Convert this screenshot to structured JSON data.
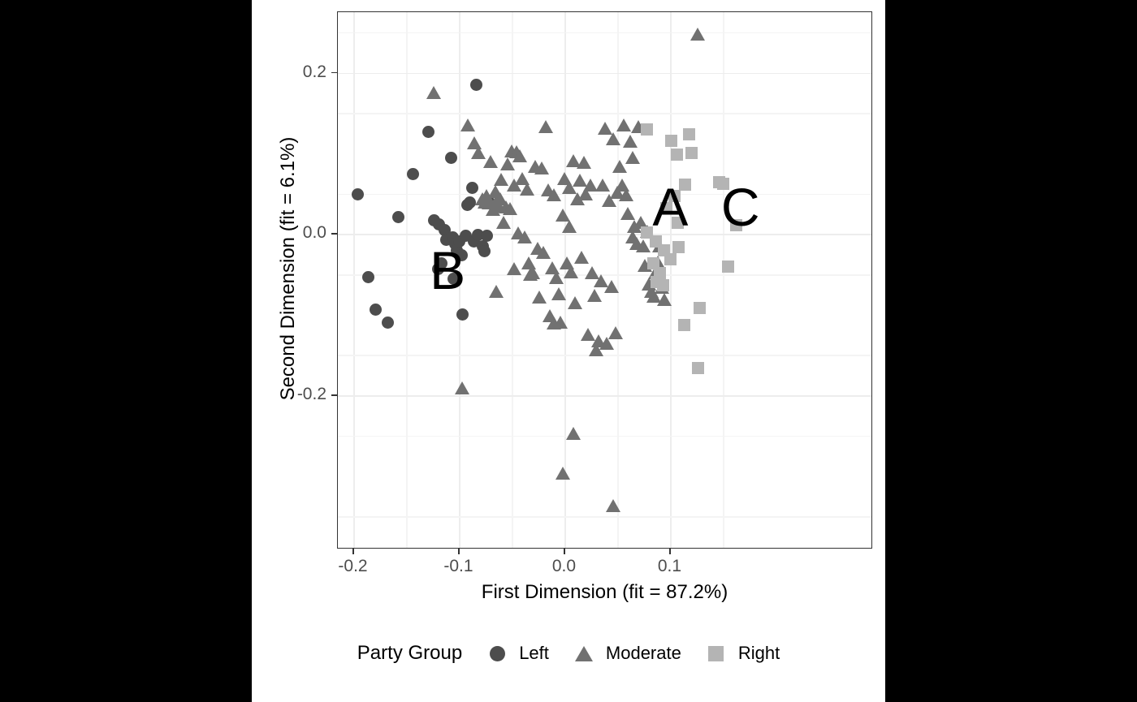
{
  "chart_data": {
    "type": "scatter",
    "title": "",
    "xlabel": "First Dimension (fit = 87.2%)",
    "ylabel": "Second Dimension (fit = 6.1%)",
    "xlim": [
      -0.215,
      0.292
    ],
    "ylim": [
      -0.391,
      0.275
    ],
    "x_ticks": [
      -0.2,
      -0.1,
      0.0,
      0.1
    ],
    "x_tick_labels": [
      "-0.2",
      "-0.1",
      "0.0",
      "0.1"
    ],
    "y_ticks": [
      0.2,
      0.0,
      -0.2
    ],
    "y_tick_labels": [
      "0.2",
      "0.0",
      "-0.2"
    ],
    "grid": true,
    "legend_position": "bottom",
    "legend_title": "Party Group",
    "colors": {
      "left": "#4d4d4d",
      "moderate": "#717171",
      "right": "#b4b4b4",
      "panel_background": "#ffffff",
      "grid_major": "#ededed",
      "grid_minor": "#f4f4f4",
      "panel_border": "#333333",
      "figure_background": "#ffffff",
      "letterbox": "#000000",
      "annotation": "#000000"
    },
    "annotations": [
      {
        "text": "A",
        "x": 0.083,
        "y": 0.034
      },
      {
        "text": "B",
        "x": -0.128,
        "y": -0.045
      },
      {
        "text": "C",
        "x": 0.148,
        "y": 0.034
      },
      {
        "text": "Left",
        "x": 0,
        "y": 0
      },
      {
        "text": "Moderate",
        "x": 0,
        "y": 0
      },
      {
        "text": "Right",
        "x": 0,
        "y": 0
      }
    ],
    "series": [
      {
        "name": "Left",
        "marker": "circle",
        "color": "#4d4d4d",
        "points": [
          [
            -0.196,
            0.049
          ],
          [
            -0.158,
            0.021
          ],
          [
            -0.144,
            0.074
          ],
          [
            -0.129,
            0.127
          ],
          [
            -0.124,
            0.017
          ],
          [
            -0.119,
            0.012
          ],
          [
            -0.117,
            -0.036
          ],
          [
            -0.114,
            0.005
          ],
          [
            -0.112,
            -0.007
          ],
          [
            -0.108,
            0.094
          ],
          [
            -0.106,
            -0.004
          ],
          [
            -0.104,
            -0.012
          ],
          [
            -0.102,
            -0.02
          ],
          [
            -0.1,
            -0.009
          ],
          [
            -0.098,
            -0.026
          ],
          [
            -0.097,
            -0.1
          ],
          [
            -0.094,
            -0.002
          ],
          [
            -0.092,
            0.036
          ],
          [
            -0.09,
            0.039
          ],
          [
            -0.088,
            0.057
          ],
          [
            -0.086,
            -0.009
          ],
          [
            -0.084,
            0.185
          ],
          [
            -0.082,
            -0.001
          ],
          [
            -0.078,
            -0.015
          ],
          [
            -0.076,
            -0.021
          ],
          [
            -0.074,
            -0.002
          ],
          [
            -0.186,
            -0.053
          ],
          [
            -0.179,
            -0.094
          ],
          [
            -0.168,
            -0.11
          ],
          [
            -0.072,
            0.04
          ],
          [
            -0.12,
            -0.043
          ],
          [
            -0.105,
            -0.055
          ]
        ]
      },
      {
        "name": "Moderate",
        "marker": "triangle",
        "color": "#717171",
        "points": [
          [
            -0.124,
            0.174
          ],
          [
            -0.092,
            0.134
          ],
          [
            -0.086,
            0.112
          ],
          [
            -0.082,
            0.1
          ],
          [
            -0.078,
            0.043
          ],
          [
            -0.076,
            0.039
          ],
          [
            -0.074,
            0.047
          ],
          [
            -0.072,
            0.038
          ],
          [
            -0.07,
            0.089
          ],
          [
            -0.068,
            0.03
          ],
          [
            -0.066,
            0.052
          ],
          [
            -0.065,
            0.04
          ],
          [
            -0.063,
            0.034
          ],
          [
            -0.061,
            0.043
          ],
          [
            -0.06,
            0.067
          ],
          [
            -0.058,
            0.013
          ],
          [
            -0.056,
            0.033
          ],
          [
            -0.054,
            0.086
          ],
          [
            -0.052,
            0.031
          ],
          [
            -0.05,
            0.102
          ],
          [
            -0.048,
            0.06
          ],
          [
            -0.046,
            0.101
          ],
          [
            -0.044,
            0.0
          ],
          [
            -0.043,
            0.096
          ],
          [
            -0.04,
            0.068
          ],
          [
            -0.038,
            -0.005
          ],
          [
            -0.036,
            0.055
          ],
          [
            -0.034,
            -0.037
          ],
          [
            -0.033,
            -0.051
          ],
          [
            -0.03,
            -0.049
          ],
          [
            -0.028,
            0.083
          ],
          [
            -0.026,
            -0.019
          ],
          [
            -0.024,
            -0.079
          ],
          [
            -0.022,
            0.081
          ],
          [
            -0.02,
            -0.024
          ],
          [
            -0.018,
            0.132
          ],
          [
            -0.016,
            0.054
          ],
          [
            -0.014,
            -0.102
          ],
          [
            -0.012,
            -0.043
          ],
          [
            -0.01,
            0.048
          ],
          [
            -0.008,
            -0.055
          ],
          [
            -0.006,
            -0.075
          ],
          [
            -0.004,
            -0.11
          ],
          [
            -0.002,
            0.022
          ],
          [
            0.0,
            0.068
          ],
          [
            0.002,
            -0.037
          ],
          [
            0.004,
            0.057
          ],
          [
            0.006,
            -0.048
          ],
          [
            0.008,
            0.09
          ],
          [
            0.01,
            -0.086
          ],
          [
            0.012,
            0.043
          ],
          [
            0.014,
            0.066
          ],
          [
            0.016,
            -0.03
          ],
          [
            0.018,
            0.088
          ],
          [
            0.02,
            0.049
          ],
          [
            0.022,
            -0.125
          ],
          [
            0.024,
            0.06
          ],
          [
            0.026,
            -0.049
          ],
          [
            0.028,
            -0.077
          ],
          [
            0.03,
            -0.145
          ],
          [
            0.032,
            -0.133
          ],
          [
            0.034,
            -0.059
          ],
          [
            0.036,
            0.06
          ],
          [
            0.038,
            0.13
          ],
          [
            0.04,
            -0.136
          ],
          [
            0.042,
            0.041
          ],
          [
            0.044,
            -0.066
          ],
          [
            0.046,
            0.117
          ],
          [
            0.048,
            -0.123
          ],
          [
            0.05,
            0.051
          ],
          [
            0.052,
            0.083
          ],
          [
            0.054,
            0.06
          ],
          [
            0.056,
            0.134
          ],
          [
            0.058,
            0.048
          ],
          [
            0.06,
            0.024
          ],
          [
            0.062,
            0.114
          ],
          [
            0.064,
            -0.005
          ],
          [
            0.066,
            0.008
          ],
          [
            0.068,
            -0.013
          ],
          [
            0.07,
            0.132
          ],
          [
            0.072,
            0.013
          ],
          [
            0.074,
            -0.016
          ],
          [
            0.076,
            -0.04
          ],
          [
            0.078,
            0.002
          ],
          [
            0.08,
            -0.063
          ],
          [
            0.082,
            -0.072
          ],
          [
            0.084,
            -0.078
          ],
          [
            0.086,
            -0.049
          ],
          [
            0.088,
            -0.036
          ],
          [
            0.09,
            -0.016
          ],
          [
            0.092,
            -0.067
          ],
          [
            0.094,
            -0.082
          ],
          [
            0.126,
            0.247
          ],
          [
            -0.097,
            -0.192
          ],
          [
            0.008,
            -0.248
          ],
          [
            -0.002,
            -0.297
          ],
          [
            0.046,
            -0.338
          ],
          [
            -0.01,
            -0.111
          ],
          [
            0.004,
            0.008
          ],
          [
            -0.065,
            -0.072
          ],
          [
            -0.048,
            -0.044
          ],
          [
            0.064,
            0.094
          ]
        ]
      },
      {
        "name": "Right",
        "marker": "square",
        "color": "#b4b4b4",
        "points": [
          [
            0.078,
            0.13
          ],
          [
            0.101,
            0.116
          ],
          [
            0.106,
            0.098
          ],
          [
            0.118,
            0.124
          ],
          [
            0.12,
            0.1
          ],
          [
            0.114,
            0.061
          ],
          [
            0.146,
            0.064
          ],
          [
            0.15,
            0.062
          ],
          [
            0.096,
            0.032
          ],
          [
            0.107,
            0.014
          ],
          [
            0.162,
            0.011
          ],
          [
            0.078,
            0.002
          ],
          [
            0.086,
            -0.009
          ],
          [
            0.094,
            -0.02
          ],
          [
            0.108,
            -0.016
          ],
          [
            0.1,
            -0.031
          ],
          [
            0.155,
            -0.04
          ],
          [
            0.084,
            -0.036
          ],
          [
            0.087,
            -0.06
          ],
          [
            0.093,
            -0.064
          ],
          [
            0.128,
            -0.092
          ],
          [
            0.113,
            -0.113
          ],
          [
            0.126,
            -0.166
          ],
          [
            0.09,
            -0.048
          ],
          [
            0.104,
            0.047
          ]
        ]
      }
    ]
  },
  "axes": {
    "x_title": "First Dimension (fit = 87.2%)",
    "y_title": "Second Dimension (fit = 6.1%)",
    "x_tick_labels": [
      "-0.2",
      "-0.1",
      "0.0",
      "0.1"
    ],
    "y_tick_labels": [
      "0.2",
      "0.0",
      "-0.2"
    ]
  },
  "legend": {
    "title": "Party Group",
    "items": [
      {
        "label": "Left",
        "marker": "circle-marker-icon"
      },
      {
        "label": "Moderate",
        "marker": "triangle-marker-icon"
      },
      {
        "label": "Right",
        "marker": "square-marker-icon"
      }
    ]
  },
  "annotations": [
    {
      "label": "A"
    },
    {
      "label": "B"
    },
    {
      "label": "C"
    }
  ]
}
